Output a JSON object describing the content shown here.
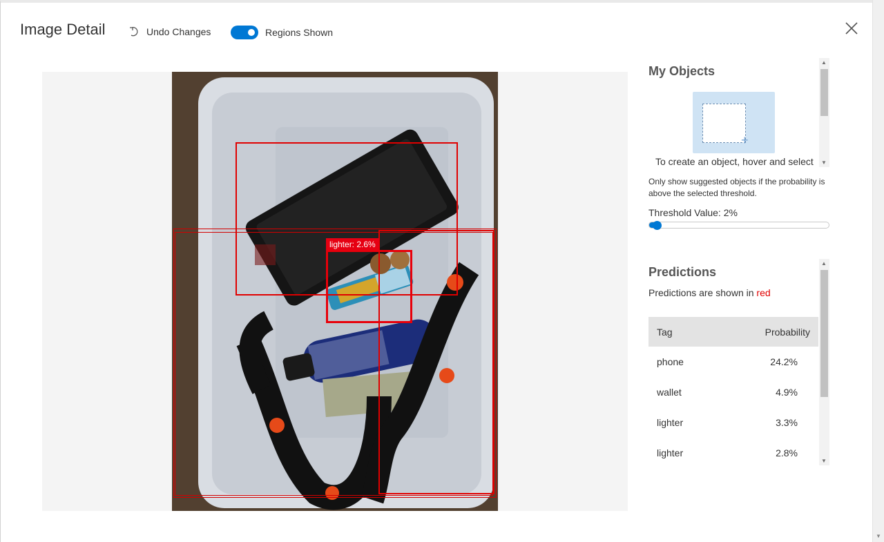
{
  "header": {
    "title": "Image Detail",
    "undo_label": "Undo Changes",
    "toggle_label": "Regions Shown",
    "toggle_on": true
  },
  "image": {
    "active_region_label": "lighter: 2.6%"
  },
  "my_objects": {
    "heading": "My Objects",
    "hint": "To create an object, hover and select",
    "threshold_note": "Only show suggested objects if the probability is above the selected threshold.",
    "threshold_label": "Threshold Value: 2%",
    "threshold_value": 0.02
  },
  "predictions": {
    "heading": "Predictions",
    "note_prefix": "Predictions are shown in ",
    "note_color_word": "red",
    "columns": [
      "Tag",
      "Probability"
    ],
    "rows": [
      {
        "tag": "phone",
        "prob": "24.2%"
      },
      {
        "tag": "wallet",
        "prob": "4.9%"
      },
      {
        "tag": "lighter",
        "prob": "3.3%"
      },
      {
        "tag": "lighter",
        "prob": "2.8%"
      }
    ]
  },
  "colors": {
    "accent": "#0078d4",
    "region": "#e00000"
  }
}
